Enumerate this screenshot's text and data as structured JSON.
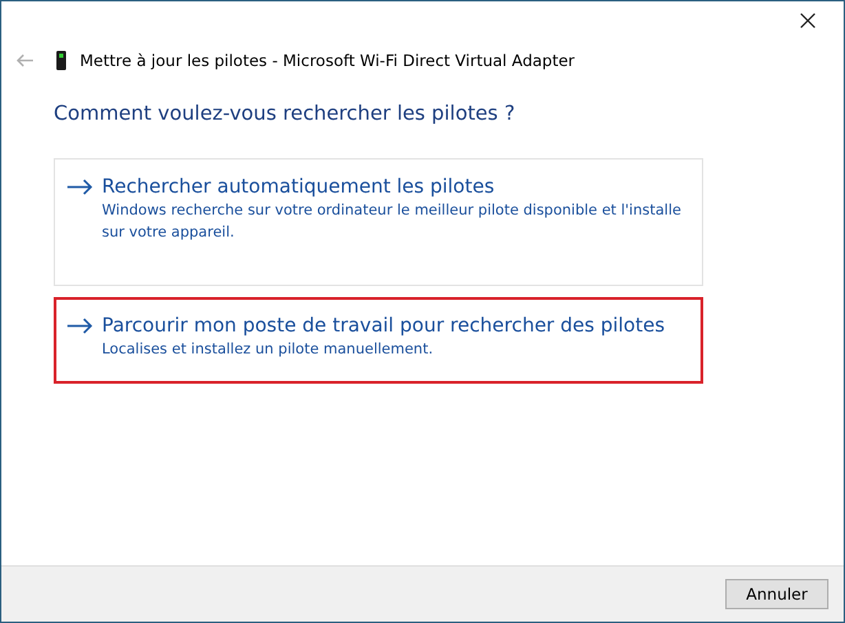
{
  "header": {
    "title": "Mettre à jour les pilotes - Microsoft Wi-Fi Direct Virtual Adapter"
  },
  "heading": "Comment voulez-vous rechercher les pilotes ?",
  "options": [
    {
      "title": "Rechercher automatiquement les pilotes",
      "description": "Windows recherche sur votre ordinateur le meilleur pilote disponible et l'installe sur votre appareil.",
      "highlighted": false
    },
    {
      "title": "Parcourir mon poste de travail pour rechercher des pilotes",
      "description": "Localises et installez un pilote manuellement.",
      "highlighted": true
    }
  ],
  "buttons": [
    "Annuler"
  ]
}
